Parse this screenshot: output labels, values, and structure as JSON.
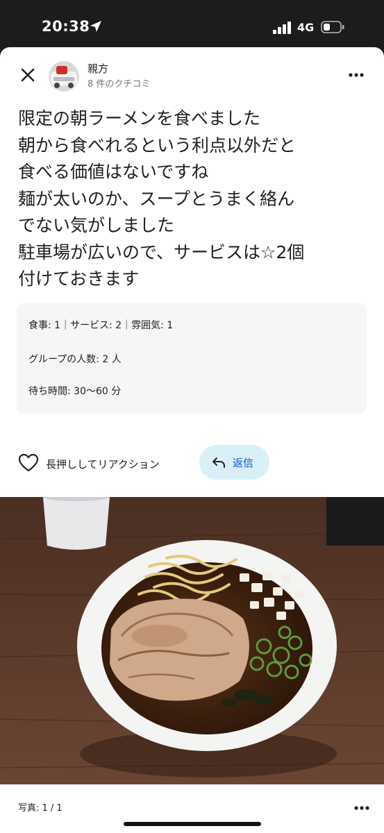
{
  "status_bar": {
    "time": "20:38",
    "network": "4G"
  },
  "header": {
    "author_name": "親方",
    "review_count": "8 件のクチコミ"
  },
  "review": {
    "lines": [
      "限定の朝ラーメンを食べました",
      "朝から食べれるという利点以外だと",
      "食べる価値はないですね",
      "麺が太いのか、スープとうまく絡ん",
      "でない気がしました",
      "駐車場が広いので、サービスは☆2個",
      "付けておきます"
    ]
  },
  "details": {
    "ratings": "食事: 1｜サービス: 2｜雰囲気: 1",
    "group_size": "グループの人数: 2 人",
    "wait_time": "待ち時間: 30〜60 分"
  },
  "actions": {
    "like_label": "長押ししてリアクション",
    "reply_label": "返信"
  },
  "photo_footer": {
    "count": "写真: 1 / 1"
  },
  "colors": {
    "reply_bg": "#d9f0f9",
    "reply_text": "#0b57d0",
    "details_bg": "#f5f6f8"
  },
  "icons": [
    "location-arrow-icon",
    "signal-icon",
    "battery-icon",
    "close-icon",
    "more-icon",
    "heart-icon",
    "reply-arrow-icon"
  ]
}
